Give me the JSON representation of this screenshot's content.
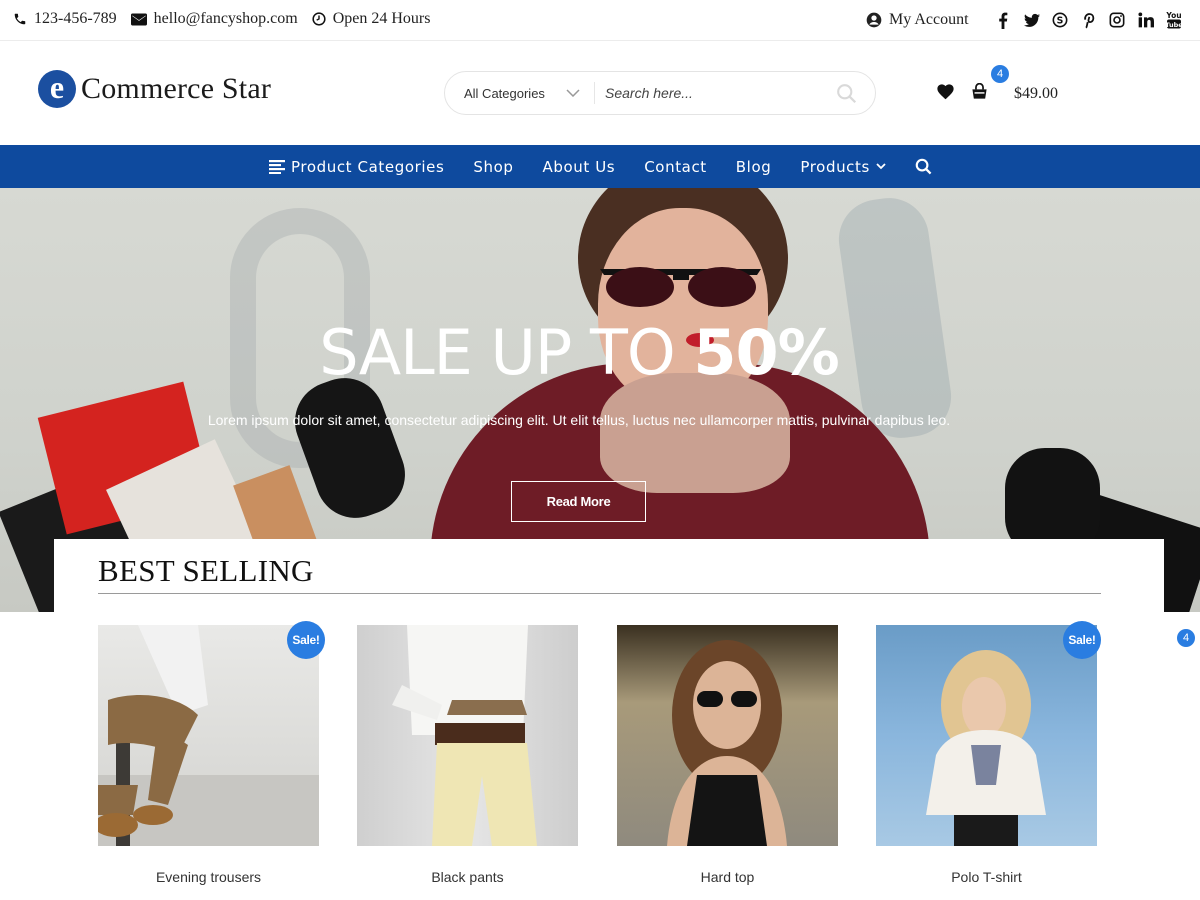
{
  "topbar": {
    "phone": "123-456-789",
    "email": "hello@fancyshop.com",
    "hours": "Open 24 Hours",
    "account_label": "My Account",
    "social_icons": [
      "facebook-icon",
      "twitter-icon",
      "skype-icon",
      "pinterest-icon",
      "instagram-icon",
      "linkedin-icon",
      "youtube-icon"
    ]
  },
  "header": {
    "logo_mark": "e",
    "logo_text": "Commerce Star",
    "search": {
      "category": "All Categories",
      "placeholder": "Search here..."
    },
    "cart_count": "4",
    "cart_total": "$49.00"
  },
  "nav": {
    "items": [
      {
        "label": "Product Categories"
      },
      {
        "label": "Shop"
      },
      {
        "label": "About Us"
      },
      {
        "label": "Contact"
      },
      {
        "label": "Blog"
      },
      {
        "label": "Products"
      }
    ]
  },
  "hero": {
    "title_light": "SALE UP TO ",
    "title_bold": "50%",
    "subtitle": "Lorem ipsum dolor sit amet, consectetur adipiscing elit. Ut elit tellus, luctus nec ullamcorper mattis, pulvinar dapibus leo.",
    "button": "Read More"
  },
  "best_selling": {
    "heading": "BEST SELLING",
    "sale_label": "Sale!",
    "products": [
      {
        "name": "Evening trousers",
        "on_sale": true
      },
      {
        "name": "Black pants",
        "on_sale": false
      },
      {
        "name": "Hard top",
        "on_sale": false
      },
      {
        "name": "Polo T-shirt",
        "on_sale": true
      }
    ]
  },
  "floating_cart_count": "4",
  "colors": {
    "brand_blue": "#0e4a9e",
    "accent_blue": "#2a7de1",
    "logo_blue": "#1b4fa0"
  }
}
